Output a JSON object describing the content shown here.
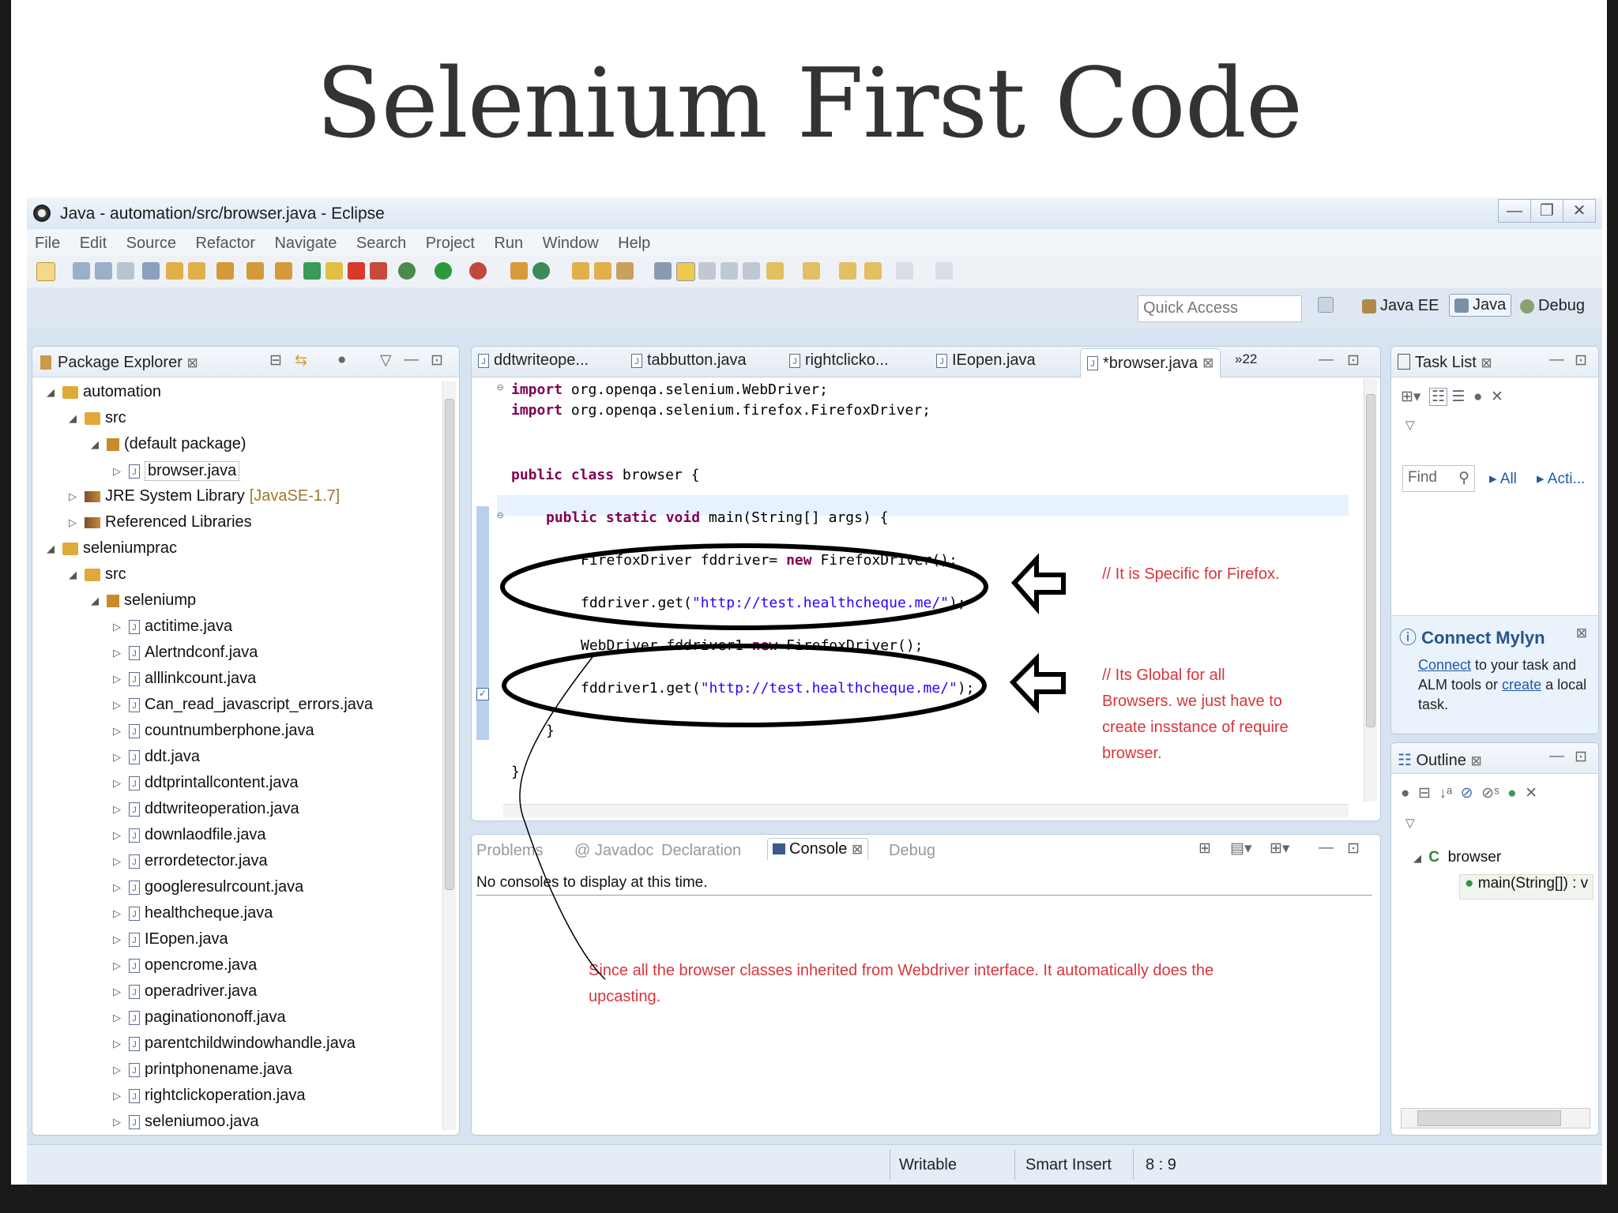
{
  "slide": {
    "title": "Selenium First Code"
  },
  "window": {
    "title": "Java - automation/src/browser.java - Eclipse",
    "controls": [
      "—",
      "❐",
      "✕"
    ]
  },
  "menu": [
    "File",
    "Edit",
    "Source",
    "Refactor",
    "Navigate",
    "Search",
    "Project",
    "Run",
    "Window",
    "Help"
  ],
  "perspective_bar": {
    "quick_access_placeholder": "Quick Access",
    "perspectives": [
      "Java EE",
      "Java",
      "Debug"
    ]
  },
  "package_explorer": {
    "title": "Package Explorer",
    "tree": [
      {
        "depth": 0,
        "arrow": "◢",
        "icon": "project-icon",
        "label": "automation"
      },
      {
        "depth": 1,
        "arrow": "◢",
        "icon": "source-folder-icon",
        "label": "src"
      },
      {
        "depth": 2,
        "arrow": "◢",
        "icon": "package-icon",
        "label": "(default package)"
      },
      {
        "depth": 3,
        "arrow": "▷",
        "icon": "java-file-icon",
        "label": "browser.java",
        "selected": true
      },
      {
        "depth": 1,
        "arrow": "▷",
        "icon": "library-icon",
        "label": "JRE System Library",
        "extra": "[JavaSE-1.7]"
      },
      {
        "depth": 1,
        "arrow": "▷",
        "icon": "library-icon",
        "label": "Referenced Libraries"
      },
      {
        "depth": 0,
        "arrow": "◢",
        "icon": "project-icon",
        "label": "seleniumprac"
      },
      {
        "depth": 1,
        "arrow": "◢",
        "icon": "source-folder-icon",
        "label": "src"
      },
      {
        "depth": 2,
        "arrow": "◢",
        "icon": "package-icon",
        "label": "seleniump"
      },
      {
        "depth": 3,
        "arrow": "▷",
        "icon": "java-file-icon",
        "label": "actitime.java"
      },
      {
        "depth": 3,
        "arrow": "▷",
        "icon": "java-file-icon",
        "label": "Alertndconf.java"
      },
      {
        "depth": 3,
        "arrow": "▷",
        "icon": "java-file-icon",
        "label": "alllinkcount.java"
      },
      {
        "depth": 3,
        "arrow": "▷",
        "icon": "java-file-icon",
        "label": "Can_read_javascript_errors.java"
      },
      {
        "depth": 3,
        "arrow": "▷",
        "icon": "java-file-icon",
        "label": "countnumberphone.java"
      },
      {
        "depth": 3,
        "arrow": "▷",
        "icon": "java-file-icon",
        "label": "ddt.java"
      },
      {
        "depth": 3,
        "arrow": "▷",
        "icon": "java-file-icon",
        "label": "ddtprintallcontent.java"
      },
      {
        "depth": 3,
        "arrow": "▷",
        "icon": "java-file-icon",
        "label": "ddtwriteoperation.java"
      },
      {
        "depth": 3,
        "arrow": "▷",
        "icon": "java-file-icon",
        "label": "downlaodfile.java"
      },
      {
        "depth": 3,
        "arrow": "▷",
        "icon": "java-file-icon",
        "label": "errordetector.java"
      },
      {
        "depth": 3,
        "arrow": "▷",
        "icon": "java-file-icon",
        "label": "googleresulrcount.java"
      },
      {
        "depth": 3,
        "arrow": "▷",
        "icon": "java-file-icon",
        "label": "healthcheque.java"
      },
      {
        "depth": 3,
        "arrow": "▷",
        "icon": "java-file-icon",
        "label": "IEopen.java"
      },
      {
        "depth": 3,
        "arrow": "▷",
        "icon": "java-file-icon",
        "label": "opencrome.java"
      },
      {
        "depth": 3,
        "arrow": "▷",
        "icon": "java-file-icon",
        "label": "operadriver.java"
      },
      {
        "depth": 3,
        "arrow": "▷",
        "icon": "java-file-icon",
        "label": "paginationonoff.java"
      },
      {
        "depth": 3,
        "arrow": "▷",
        "icon": "java-file-icon",
        "label": "parentchildwindowhandle.java"
      },
      {
        "depth": 3,
        "arrow": "▷",
        "icon": "java-file-icon",
        "label": "printphonename.java"
      },
      {
        "depth": 3,
        "arrow": "▷",
        "icon": "java-file-icon",
        "label": "rightclickoperation.java"
      },
      {
        "depth": 3,
        "arrow": "▷",
        "icon": "java-file-icon",
        "label": "seleniumoo.java"
      }
    ]
  },
  "editor": {
    "tabs": [
      "ddtwriteope...",
      "tabbutton.java",
      "rightclicko...",
      "IEopen.java",
      "*browser.java"
    ],
    "overflow": "»22",
    "code": {
      "imp1_kw": "import",
      "imp1": " org.openqa.selenium.WebDriver;",
      "imp2_kw": "import",
      "imp2": " org.openqa.selenium.firefox.FirefoxDriver;",
      "cls_kw": "public class",
      "cls": " browser {",
      "main_kw": "public static void",
      "main": " main(String[] args) {",
      "l1a": "FirefoxDriver fddriver= ",
      "l1_kw": "new",
      "l1b": " FirefoxDriver();",
      "l2a": "fddriver.get(",
      "l2_str": "\"http://test.healthcheque.me/\"",
      "l2b": ");",
      "l3a": "WebDriver fddriver1=",
      "l3_kw": "new",
      "l3b": " FirefoxDriver();",
      "l4a": "fddriver1.get(",
      "l4_str": "\"http://test.healthcheque.me/\"",
      "l4b": ");",
      "close1": "}",
      "close2": "}"
    },
    "annotation1": "// It is Specific for Firefox.",
    "annotation2": "// Its Global for all Browsers. we just have to create insstance of require browser."
  },
  "bottom_panel": {
    "tabs": [
      "Problems",
      "@ Javadoc",
      "Declaration",
      "Console",
      "Debug"
    ],
    "message": "No consoles to display at this time.",
    "annotation": "Since all the browser classes inherited from Webdriver interface. It automatically does the upcasting."
  },
  "task_list": {
    "title": "Task List",
    "find_placeholder": "Find",
    "filters": [
      "All",
      "Acti..."
    ]
  },
  "mylyn": {
    "title": "Connect Mylyn",
    "link1": "Connect",
    "text1": " to your task and ALM tools or ",
    "link2": "create",
    "text2": " a local task."
  },
  "outline": {
    "title": "Outline",
    "class": "browser",
    "method": "main(String[]) : v"
  },
  "statusbar": {
    "mode": "Writable",
    "insert": "Smart Insert",
    "position": "8 : 9"
  },
  "colors": {
    "keyword": "#7f0055",
    "string": "#2a00ff",
    "annotation": "#d8353a",
    "ide_bg": "#d7e3f0"
  }
}
